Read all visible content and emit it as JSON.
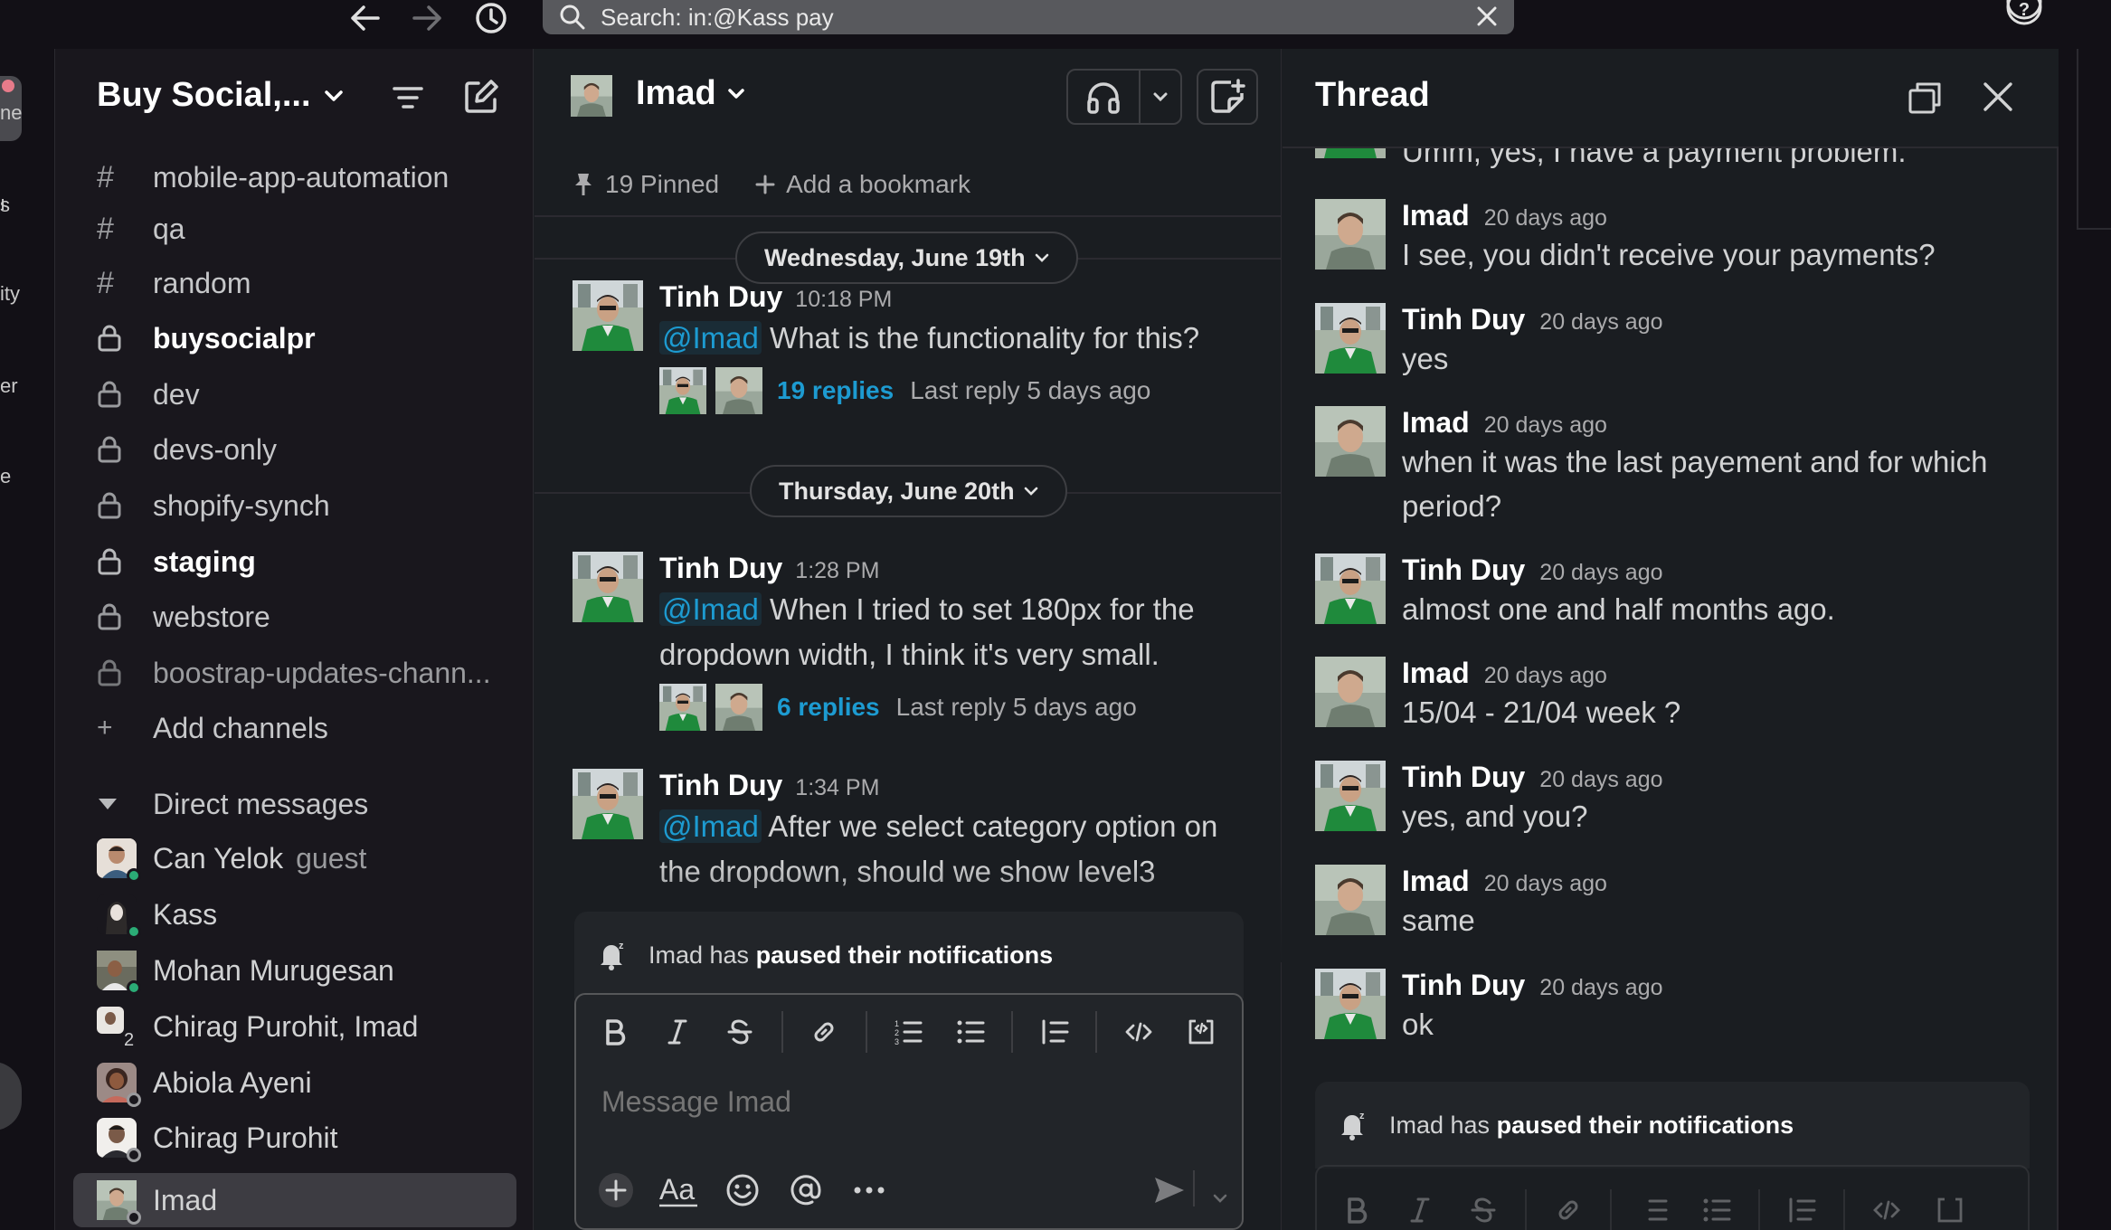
{
  "search": {
    "query": "Search: in:@Kass pay"
  },
  "rail": {
    "fragments": [
      "ne",
      "s",
      "ity",
      "er",
      "e"
    ]
  },
  "sidebar": {
    "workspace_name": "Buy Social,...",
    "channels": [
      {
        "label": "mobile-app-automation",
        "type": "public",
        "unread": false
      },
      {
        "label": "qa",
        "type": "public",
        "unread": false
      },
      {
        "label": "random",
        "type": "public",
        "unread": false
      },
      {
        "label": "buysocialpr",
        "type": "private",
        "unread": true
      },
      {
        "label": "dev",
        "type": "private",
        "unread": false
      },
      {
        "label": "devs-only",
        "type": "private",
        "unread": false
      },
      {
        "label": "shopify-synch",
        "type": "private",
        "unread": false
      },
      {
        "label": "staging",
        "type": "private",
        "unread": true
      },
      {
        "label": "webstore",
        "type": "private",
        "unread": false
      },
      {
        "label": "boostrap-updates-chann...",
        "type": "private",
        "unread": false
      }
    ],
    "add_channels": "Add channels",
    "dm_section": "Direct messages",
    "dms": [
      {
        "label": "Can Yelok",
        "tag": "guest"
      },
      {
        "label": "Kass",
        "tag": ""
      },
      {
        "label": "Mohan Murugesan",
        "tag": ""
      },
      {
        "label": "Chirag Purohit, Imad",
        "tag": "",
        "count": "2"
      },
      {
        "label": "Abiola Ayeni",
        "tag": ""
      },
      {
        "label": "Chirag Purohit",
        "tag": ""
      },
      {
        "label": "Imad",
        "tag": "",
        "active": true
      }
    ]
  },
  "channel": {
    "title": "Imad",
    "pinned": "19 Pinned",
    "add_bookmark": "Add a bookmark",
    "date1": "Wednesday, June 19th",
    "date2": "Thursday, June 20th",
    "messages": [
      {
        "author": "Tinh Duy",
        "time": "10:18 PM",
        "mention": "@Imad",
        "text": "What is the functionality for this?",
        "replies": "19 replies",
        "last_reply": "Last reply 5 days ago"
      },
      {
        "author": "Tinh Duy",
        "time": "1:28 PM",
        "mention": "@Imad",
        "text": "When I tried to set 180px for the dropdown width, I think it's very small.",
        "replies": "6 replies",
        "last_reply": "Last reply 5 days ago"
      },
      {
        "author": "Tinh Duy",
        "time": "1:34 PM",
        "mention": "@Imad",
        "text": "After we select category option on the dropdown,  should we show level3"
      }
    ],
    "notice_pre": "Imad has",
    "notice_bold": "paused their notifications",
    "composer_placeholder": "Message Imad"
  },
  "thread": {
    "title": "Thread",
    "partial_text": "Umm, yes, I have a payment problem.",
    "messages": [
      {
        "author": "Imad",
        "time": "20 days ago",
        "text": "I see, you didn't receive your payments?"
      },
      {
        "author": "Tinh Duy",
        "time": "20 days ago",
        "text": "yes"
      },
      {
        "author": "Imad",
        "time": "20 days ago",
        "text": "when it was the last payement and for which period?"
      },
      {
        "author": "Tinh Duy",
        "time": "20 days ago",
        "text": "almost one and half months ago."
      },
      {
        "author": "Imad",
        "time": "20 days ago",
        "text": "15/04 - 21/04  week ?"
      },
      {
        "author": "Tinh Duy",
        "time": "20 days ago",
        "text": "yes, and you?"
      },
      {
        "author": "Imad",
        "time": "20 days ago",
        "text": "same"
      },
      {
        "author": "Tinh Duy",
        "time": "20 days ago",
        "text": "ok"
      }
    ],
    "notice_pre": "Imad has",
    "notice_bold": "paused their notifications"
  },
  "colors": {
    "background": "#1a1d21",
    "sidebar": "#19171d",
    "link": "#1d9bd1",
    "online": "#2bac76"
  }
}
